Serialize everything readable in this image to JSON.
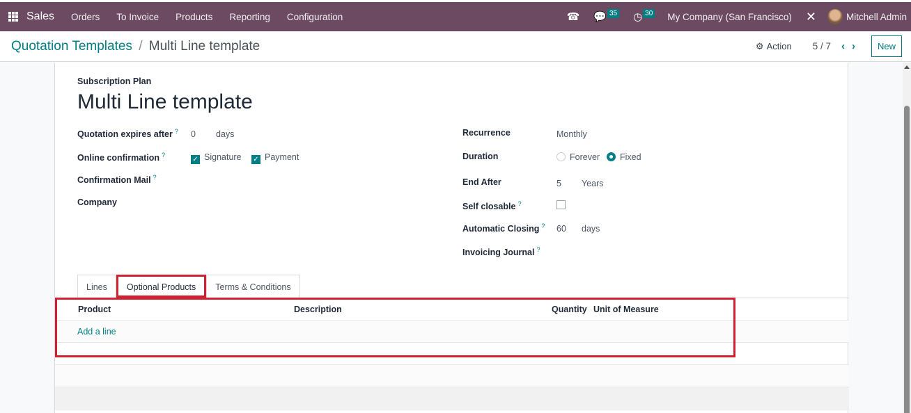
{
  "navbar": {
    "app_name": "Sales",
    "menu": [
      "Orders",
      "To Invoice",
      "Products",
      "Reporting",
      "Configuration"
    ],
    "messages_count": "35",
    "activities_count": "30",
    "company": "My Company (San Francisco)",
    "user": "Mitchell Admin",
    "icons": {
      "apps": "grid-icon",
      "phone": "phone-icon",
      "messages": "chat-icon",
      "activities": "clock-icon",
      "debug": "tools-icon"
    }
  },
  "control": {
    "breadcrumb_parent": "Quotation Templates",
    "breadcrumb_sep": "/",
    "breadcrumb_current": "Multi Line template",
    "action_label": "Action",
    "pager": "5 / 7",
    "new_label": "New"
  },
  "form": {
    "plan_label": "Subscription Plan",
    "title": "Multi Line template",
    "left_fields": {
      "expires_label": "Quotation expires after",
      "expires_value": "0",
      "expires_unit": "days",
      "online_conf_label": "Online confirmation",
      "signature_label": "Signature",
      "signature_checked": true,
      "payment_label": "Payment",
      "payment_checked": true,
      "conf_mail_label": "Confirmation Mail",
      "company_label": "Company"
    },
    "right_fields": {
      "recurrence_label": "Recurrence",
      "recurrence_value": "Monthly",
      "duration_label": "Duration",
      "duration_forever": "Forever",
      "duration_fixed": "Fixed",
      "duration_selected": "Fixed",
      "end_after_label": "End After",
      "end_after_value": "5",
      "end_after_unit": "Years",
      "self_closable_label": "Self closable",
      "self_closable_checked": false,
      "auto_closing_label": "Automatic Closing",
      "auto_closing_value": "60",
      "auto_closing_unit": "days",
      "invoicing_journal_label": "Invoicing Journal"
    },
    "help_mark": "?"
  },
  "tabs": [
    {
      "label": "Lines",
      "active": false
    },
    {
      "label": "Optional Products",
      "active": true
    },
    {
      "label": "Terms & Conditions",
      "active": false
    }
  ],
  "table": {
    "columns": [
      "Product",
      "Description",
      "Quantity",
      "Unit of Measure"
    ],
    "add_line": "Add a line"
  },
  "colors": {
    "navbar": "#6b4a62",
    "accent": "#017e84",
    "highlight": "#d1202f"
  }
}
